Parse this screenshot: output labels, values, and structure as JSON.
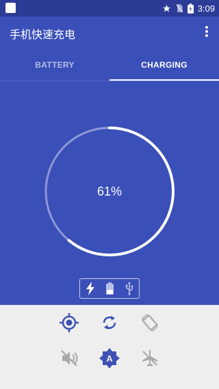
{
  "status_bar": {
    "time": "3:09",
    "icons": [
      "notification-square-icon",
      "star-icon",
      "no-sim-icon",
      "battery-charging-icon"
    ]
  },
  "app_bar": {
    "title": "手机快速充电",
    "menu_icon": "more-vert-icon"
  },
  "tabs": [
    {
      "label": "BATTERY",
      "selected": false
    },
    {
      "label": "CHARGING",
      "selected": true
    }
  ],
  "charging": {
    "percent_label": "61%",
    "progress": 0.61
  },
  "charge_modes": [
    "bolt-icon",
    "battery-icon",
    "usb-icon"
  ],
  "quick_settings": [
    {
      "name": "location-icon",
      "active": true
    },
    {
      "name": "sync-icon",
      "active": true
    },
    {
      "name": "auto-rotate-icon",
      "active": false
    },
    {
      "name": "mute-icon",
      "active": false
    },
    {
      "name": "auto-brightness-icon",
      "active": true
    },
    {
      "name": "airplane-mode-icon",
      "active": false
    }
  ],
  "colors": {
    "primary": "#3b4fb8",
    "status_bar": "#2b3b96",
    "active_icon": "#3f51b5",
    "inactive_icon": "#a9a9a9",
    "tiles_bg": "#eeeeee"
  }
}
